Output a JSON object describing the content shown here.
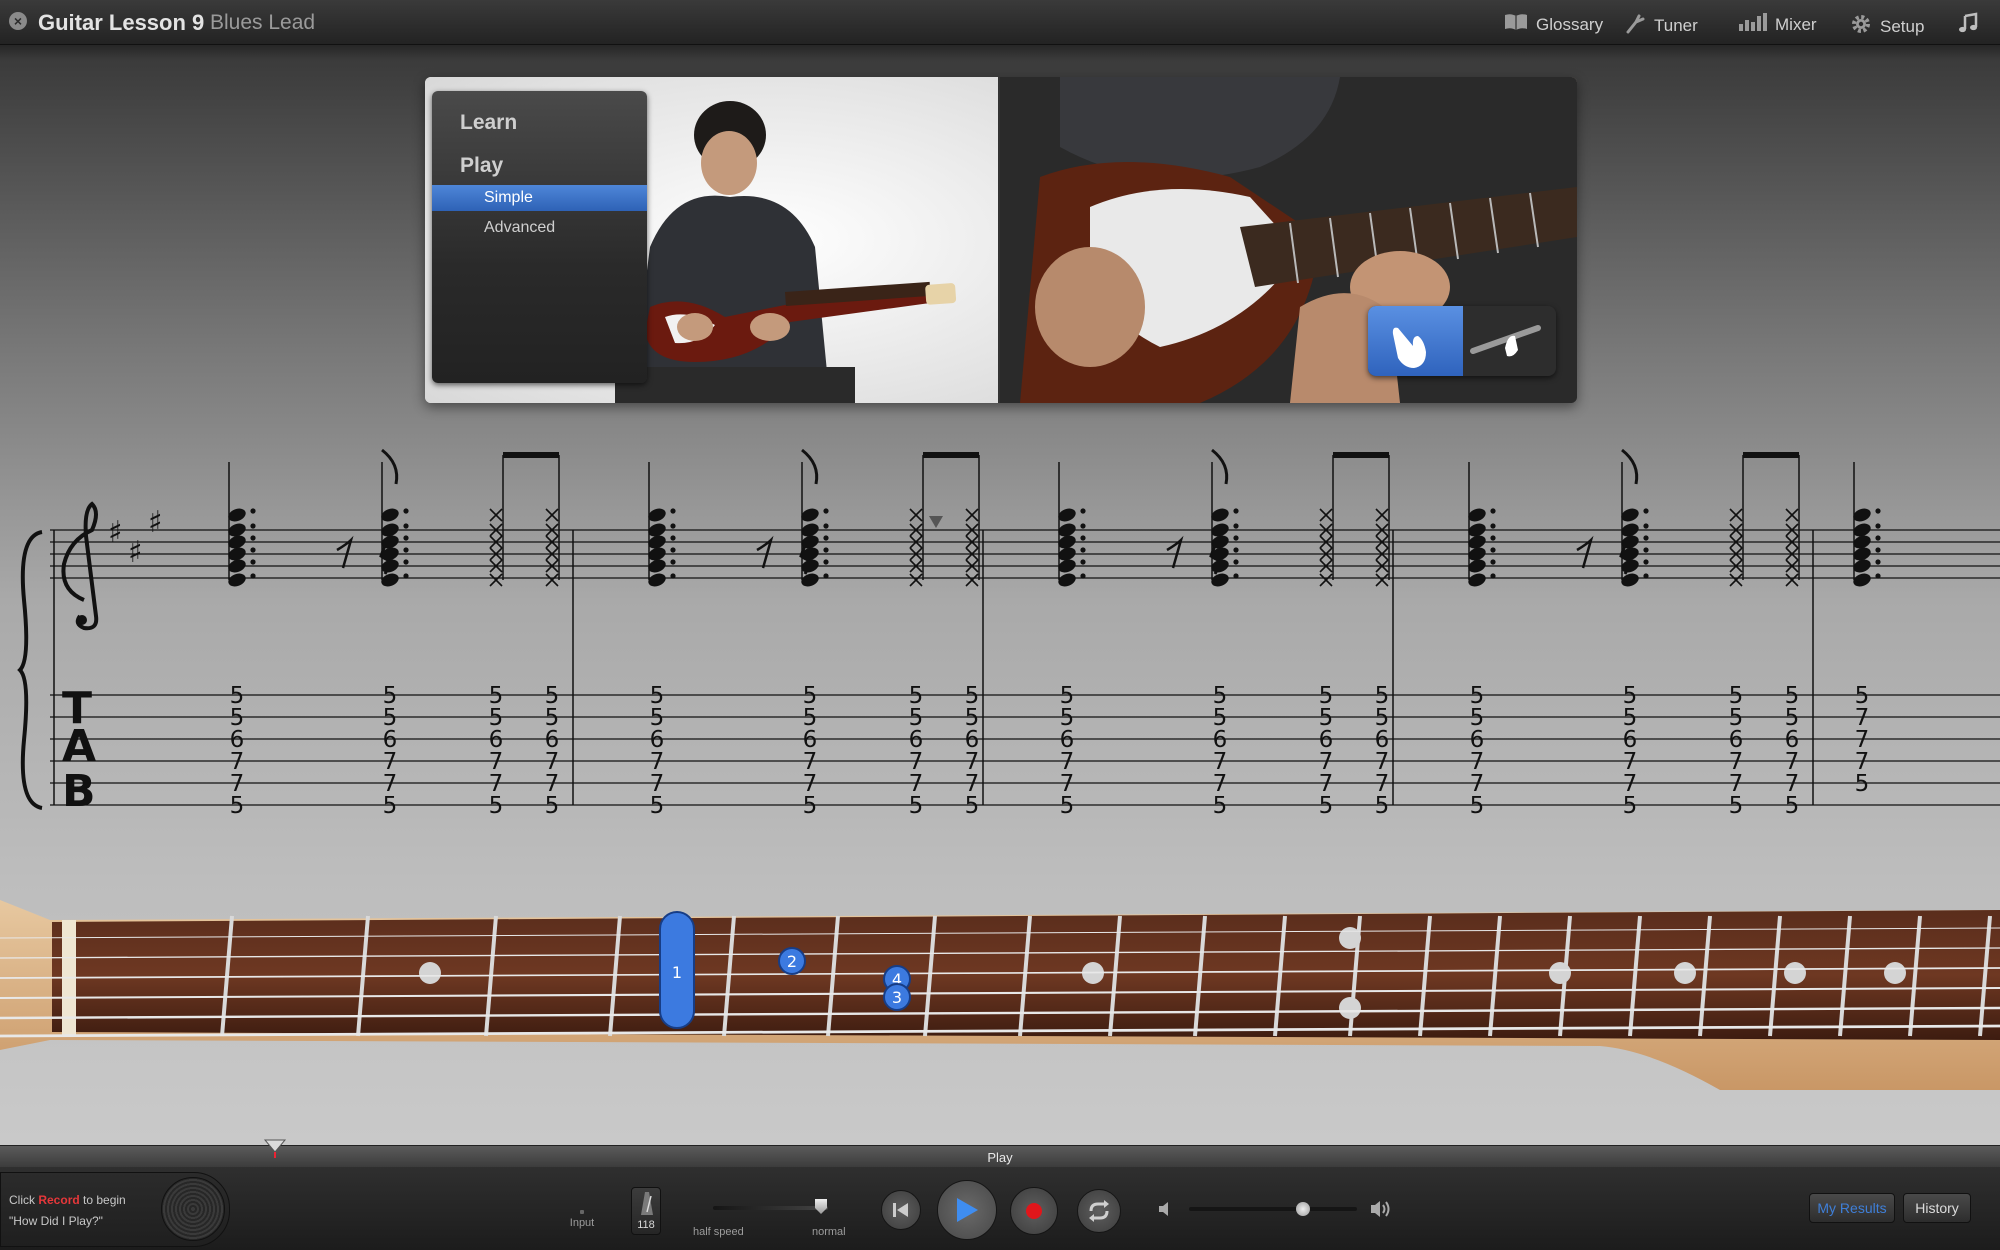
{
  "window": {
    "title": "Guitar Lesson 9",
    "subtitle": "Blues Lead"
  },
  "toolbar": {
    "items": [
      {
        "label": "Glossary",
        "icon": "book-icon"
      },
      {
        "label": "Tuner",
        "icon": "tuning-fork-icon"
      },
      {
        "label": "Mixer",
        "icon": "mixer-icon"
      },
      {
        "label": "Setup",
        "icon": "gear-icon"
      }
    ],
    "extra_icon": "music-note-icon"
  },
  "lesson_menu": {
    "learn": "Learn",
    "play": "Play",
    "options": [
      {
        "label": "Simple",
        "selected": true
      },
      {
        "label": "Advanced",
        "selected": false
      }
    ]
  },
  "view_toggle": {
    "left_icon": "hand-icon",
    "right_icon": "guitar-neck-icon",
    "selected": "left"
  },
  "notation": {
    "key": "A major (3 sharps)",
    "tab_label": [
      "T",
      "A",
      "B"
    ],
    "measures": [
      {
        "chords": [
          [
            "5",
            "5",
            "6",
            "7",
            "7",
            "5"
          ],
          [
            "5",
            "5",
            "6",
            "7",
            "7",
            "5"
          ],
          [
            "5",
            "5",
            "6",
            "7",
            "7",
            "5"
          ],
          [
            "5",
            "5",
            "6",
            "7",
            "7",
            "5"
          ]
        ]
      },
      {
        "chords": [
          [
            "5",
            "5",
            "6",
            "7",
            "7",
            "5"
          ],
          [
            "5",
            "5",
            "6",
            "7",
            "7",
            "5"
          ],
          [
            "5",
            "5",
            "6",
            "7",
            "7",
            "5"
          ],
          [
            "5",
            "5",
            "6",
            "7",
            "7",
            "5"
          ]
        ]
      },
      {
        "chords": [
          [
            "5",
            "5",
            "6",
            "7",
            "7",
            "5"
          ],
          [
            "5",
            "5",
            "6",
            "7",
            "7",
            "5"
          ],
          [
            "5",
            "5",
            "6",
            "7",
            "7",
            "5"
          ],
          [
            "5",
            "5",
            "6",
            "7",
            "7",
            "5"
          ]
        ]
      },
      {
        "chords": [
          [
            "5",
            "5",
            "6",
            "7",
            "7",
            "5"
          ],
          [
            "5",
            "5",
            "6",
            "7",
            "7",
            "5"
          ],
          [
            "5",
            "5",
            "6",
            "7",
            "7",
            "5"
          ],
          [
            "5",
            "5",
            "6",
            "7",
            "7",
            "5"
          ]
        ]
      },
      {
        "chords": [
          [
            "5",
            "7",
            "7",
            "7",
            "5",
            ""
          ]
        ]
      }
    ]
  },
  "fretboard": {
    "fingers": [
      {
        "label": "1",
        "type": "barre"
      },
      {
        "label": "2",
        "type": "dot"
      },
      {
        "label": "4",
        "type": "dot"
      },
      {
        "label": "3",
        "type": "dot"
      }
    ]
  },
  "transport": {
    "progress_label": "Play",
    "hint_line1_prefix": "Click ",
    "hint_line1_highlight": "Record",
    "hint_line1_suffix": " to begin",
    "hint_line2": "\"How Did I Play?\"",
    "input_label": "Input",
    "tempo": "118",
    "speed_left": "half speed",
    "speed_right": "normal",
    "speed_value": "normal",
    "volume_fraction": 0.68,
    "my_results": "My Results",
    "history": "History"
  }
}
